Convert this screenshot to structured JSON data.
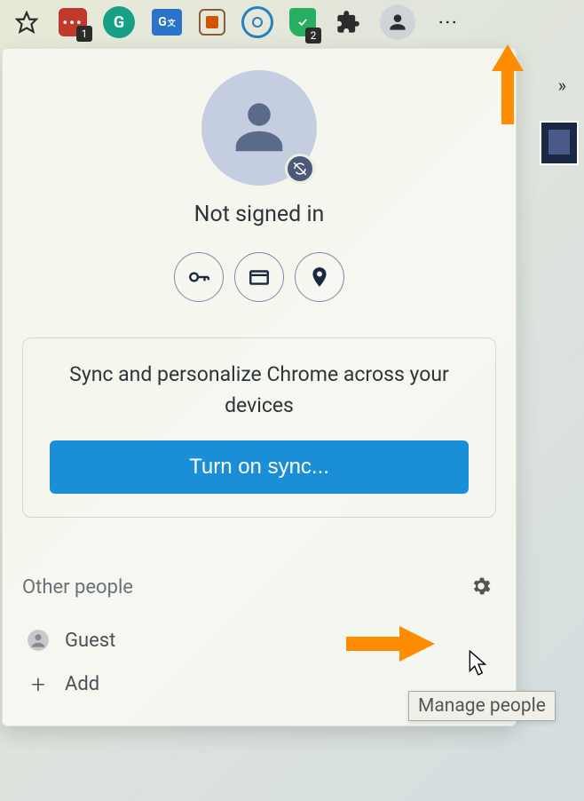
{
  "toolbar": {
    "badge1": "1",
    "badge2": "2",
    "gtranslate_label": "G"
  },
  "overflow": {
    "chevrons": "»"
  },
  "profile": {
    "status": "Not signed in",
    "sync_text": "Sync and personalize Chrome across your devices",
    "sync_button": "Turn on sync..."
  },
  "other": {
    "title": "Other people",
    "guest": "Guest",
    "add": "Add",
    "tooltip": "Manage people"
  }
}
